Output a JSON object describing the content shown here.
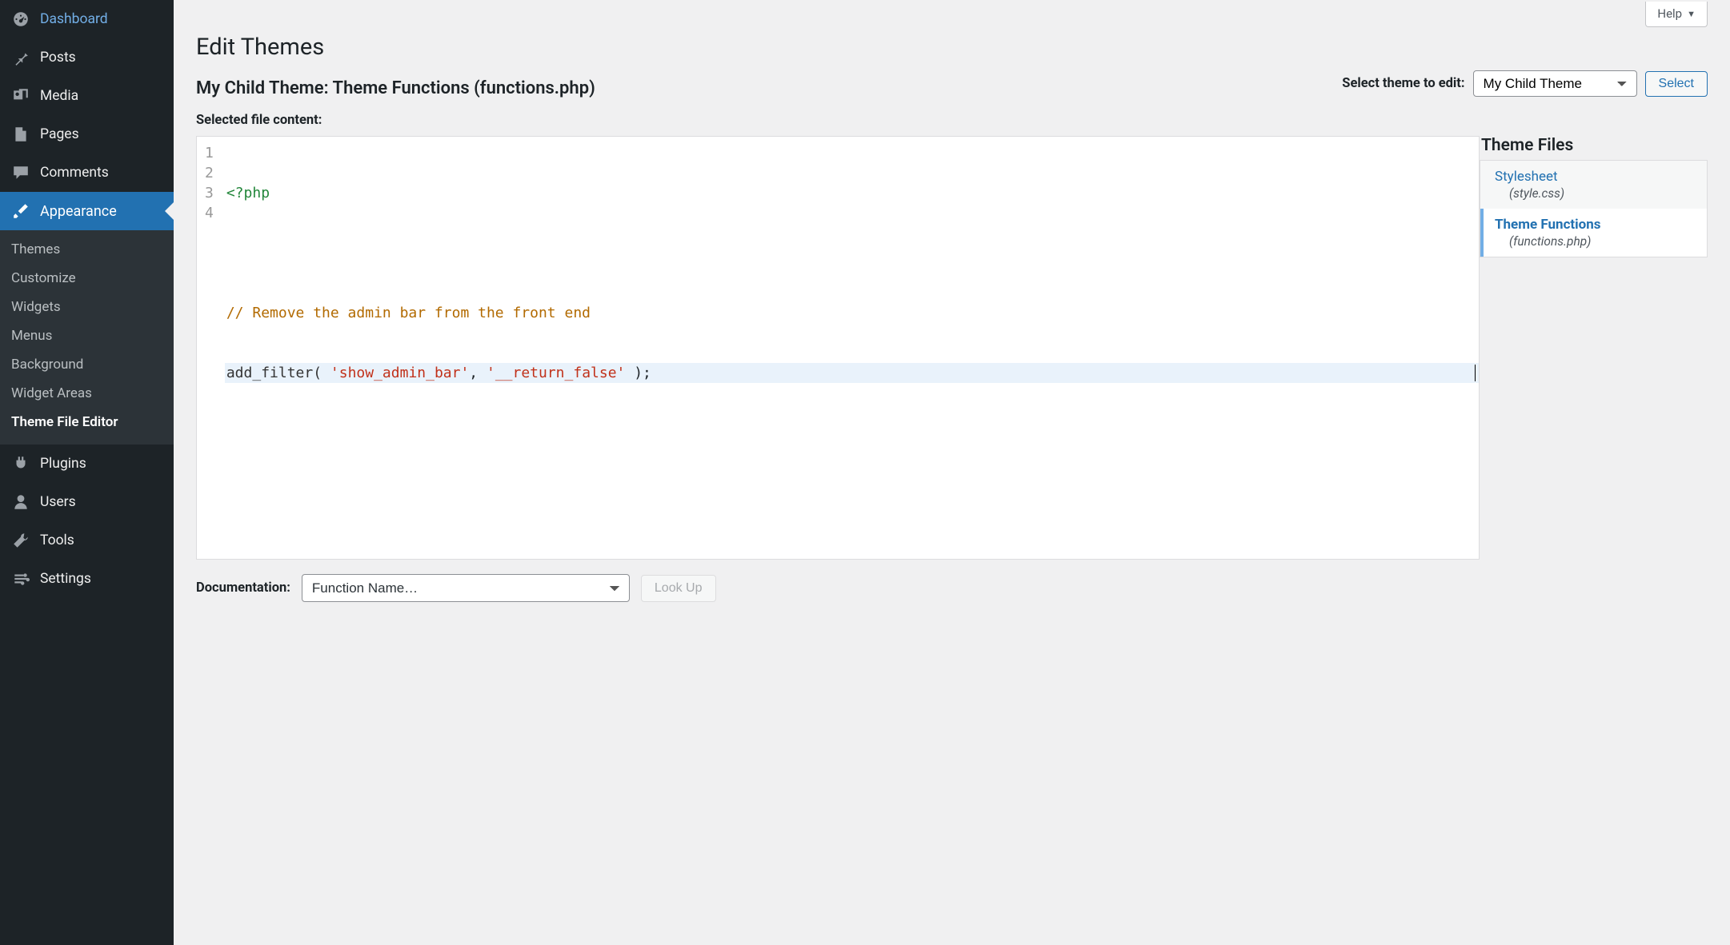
{
  "sidebar": {
    "top": [
      {
        "label": "Dashboard",
        "name": "sidebar-item-dashboard",
        "icon": "gauge"
      },
      {
        "label": "Posts",
        "name": "sidebar-item-posts",
        "icon": "pin"
      },
      {
        "label": "Media",
        "name": "sidebar-item-media",
        "icon": "media"
      },
      {
        "label": "Pages",
        "name": "sidebar-item-pages",
        "icon": "pages"
      },
      {
        "label": "Comments",
        "name": "sidebar-item-comments",
        "icon": "chat"
      },
      {
        "label": "Appearance",
        "name": "sidebar-item-appearance",
        "icon": "brush",
        "current": true
      }
    ],
    "appearance_sub": [
      {
        "label": "Themes",
        "name": "sidebar-sub-themes"
      },
      {
        "label": "Customize",
        "name": "sidebar-sub-customize"
      },
      {
        "label": "Widgets",
        "name": "sidebar-sub-widgets"
      },
      {
        "label": "Menus",
        "name": "sidebar-sub-menus"
      },
      {
        "label": "Background",
        "name": "sidebar-sub-background"
      },
      {
        "label": "Widget Areas",
        "name": "sidebar-sub-widget-areas"
      },
      {
        "label": "Theme File Editor",
        "name": "sidebar-sub-theme-file-editor",
        "active": true
      }
    ],
    "bottom": [
      {
        "label": "Plugins",
        "name": "sidebar-item-plugins",
        "icon": "plug"
      },
      {
        "label": "Users",
        "name": "sidebar-item-users",
        "icon": "user"
      },
      {
        "label": "Tools",
        "name": "sidebar-item-tools",
        "icon": "wrench"
      },
      {
        "label": "Settings",
        "name": "sidebar-item-settings",
        "icon": "sliders"
      }
    ]
  },
  "help_label": "Help",
  "page_title": "Edit Themes",
  "file_heading": "My Child Theme: Theme Functions (functions.php)",
  "theme_select": {
    "label": "Select theme to edit:",
    "value": "My Child Theme",
    "button": "Select"
  },
  "selected_file_label": "Selected file content:",
  "code": {
    "lines": [
      "1",
      "2",
      "3",
      "4"
    ],
    "l1": "<?php",
    "l3": "// Remove the admin bar from the front end",
    "l4_fn": "add_filter(",
    "l4_s1": "'show_admin_bar'",
    "l4_mid": ", ",
    "l4_s2": "'__return_false'",
    "l4_end": " );"
  },
  "files": {
    "title": "Theme Files",
    "items": [
      {
        "label": "Stylesheet",
        "file": "(style.css)",
        "name": "theme-file-stylesheet"
      },
      {
        "label": "Theme Functions",
        "file": "(functions.php)",
        "name": "theme-file-functions",
        "active": true
      }
    ]
  },
  "documentation": {
    "label": "Documentation:",
    "placeholder": "Function Name…",
    "button": "Look Up"
  }
}
